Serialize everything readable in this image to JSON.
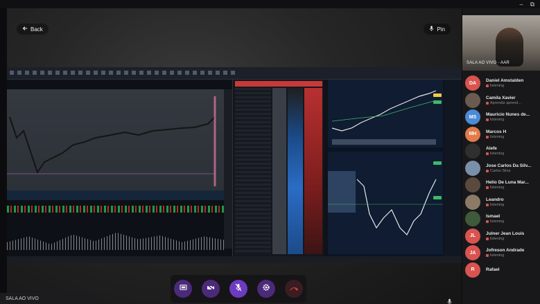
{
  "window": {
    "controls": [
      "–",
      "⧉"
    ]
  },
  "stage": {
    "back_label": "Back",
    "pin_label": "Pin",
    "footer_label": "SALA AO VIVO"
  },
  "self_view": {
    "label": "SALA AO VIVO - AAR"
  },
  "controls": [
    {
      "name": "share-screen-button",
      "icon": "screen-share-icon"
    },
    {
      "name": "camera-toggle-button",
      "icon": "camera-off-icon"
    },
    {
      "name": "mic-toggle-button",
      "icon": "microphone-off-icon"
    },
    {
      "name": "settings-button",
      "icon": "gear-icon"
    },
    {
      "name": "hang-up-button",
      "icon": "phone-hangup-icon"
    }
  ],
  "participants": [
    {
      "initials": "DA",
      "name": "Daniel Amstalden",
      "status": "listening",
      "color": "#d9534f"
    },
    {
      "initials": "",
      "name": "Camila Xavier",
      "status": "Aprendiz aprend...",
      "color": "#6a5a50"
    },
    {
      "initials": "MS",
      "name": "Mauricio Nunes de...",
      "status": "listening",
      "color": "#4b8ad6"
    },
    {
      "initials": "MH",
      "name": "Marcos H",
      "status": "listening",
      "color": "#e27b4b"
    },
    {
      "initials": "",
      "name": "Alefe",
      "status": "listening",
      "color": "#2f2f2f"
    },
    {
      "initials": "",
      "name": "Jose Carlos Da Silv...",
      "status": "Carlos Silva",
      "color": "#7a8fa8"
    },
    {
      "initials": "",
      "name": "Helio De Luna Mar...",
      "status": "listening",
      "color": "#5a4a3e"
    },
    {
      "initials": "",
      "name": "Leandro",
      "status": "listening",
      "color": "#8b7a66"
    },
    {
      "initials": "",
      "name": "Ismael",
      "status": "listening",
      "color": "#3f5a3a"
    },
    {
      "initials": "JL",
      "name": "Julner Jean Louis",
      "status": "listening",
      "color": "#d9534f"
    },
    {
      "initials": "JA",
      "name": "Jofreson Andrade",
      "status": "listening",
      "color": "#d9534f"
    },
    {
      "initials": "R",
      "name": "Rafael",
      "status": "",
      "color": "#d9534f"
    }
  ],
  "colors": {
    "accent": "#6c3bc0",
    "hangup": "#e0413a",
    "status_red": "#d9534f"
  }
}
